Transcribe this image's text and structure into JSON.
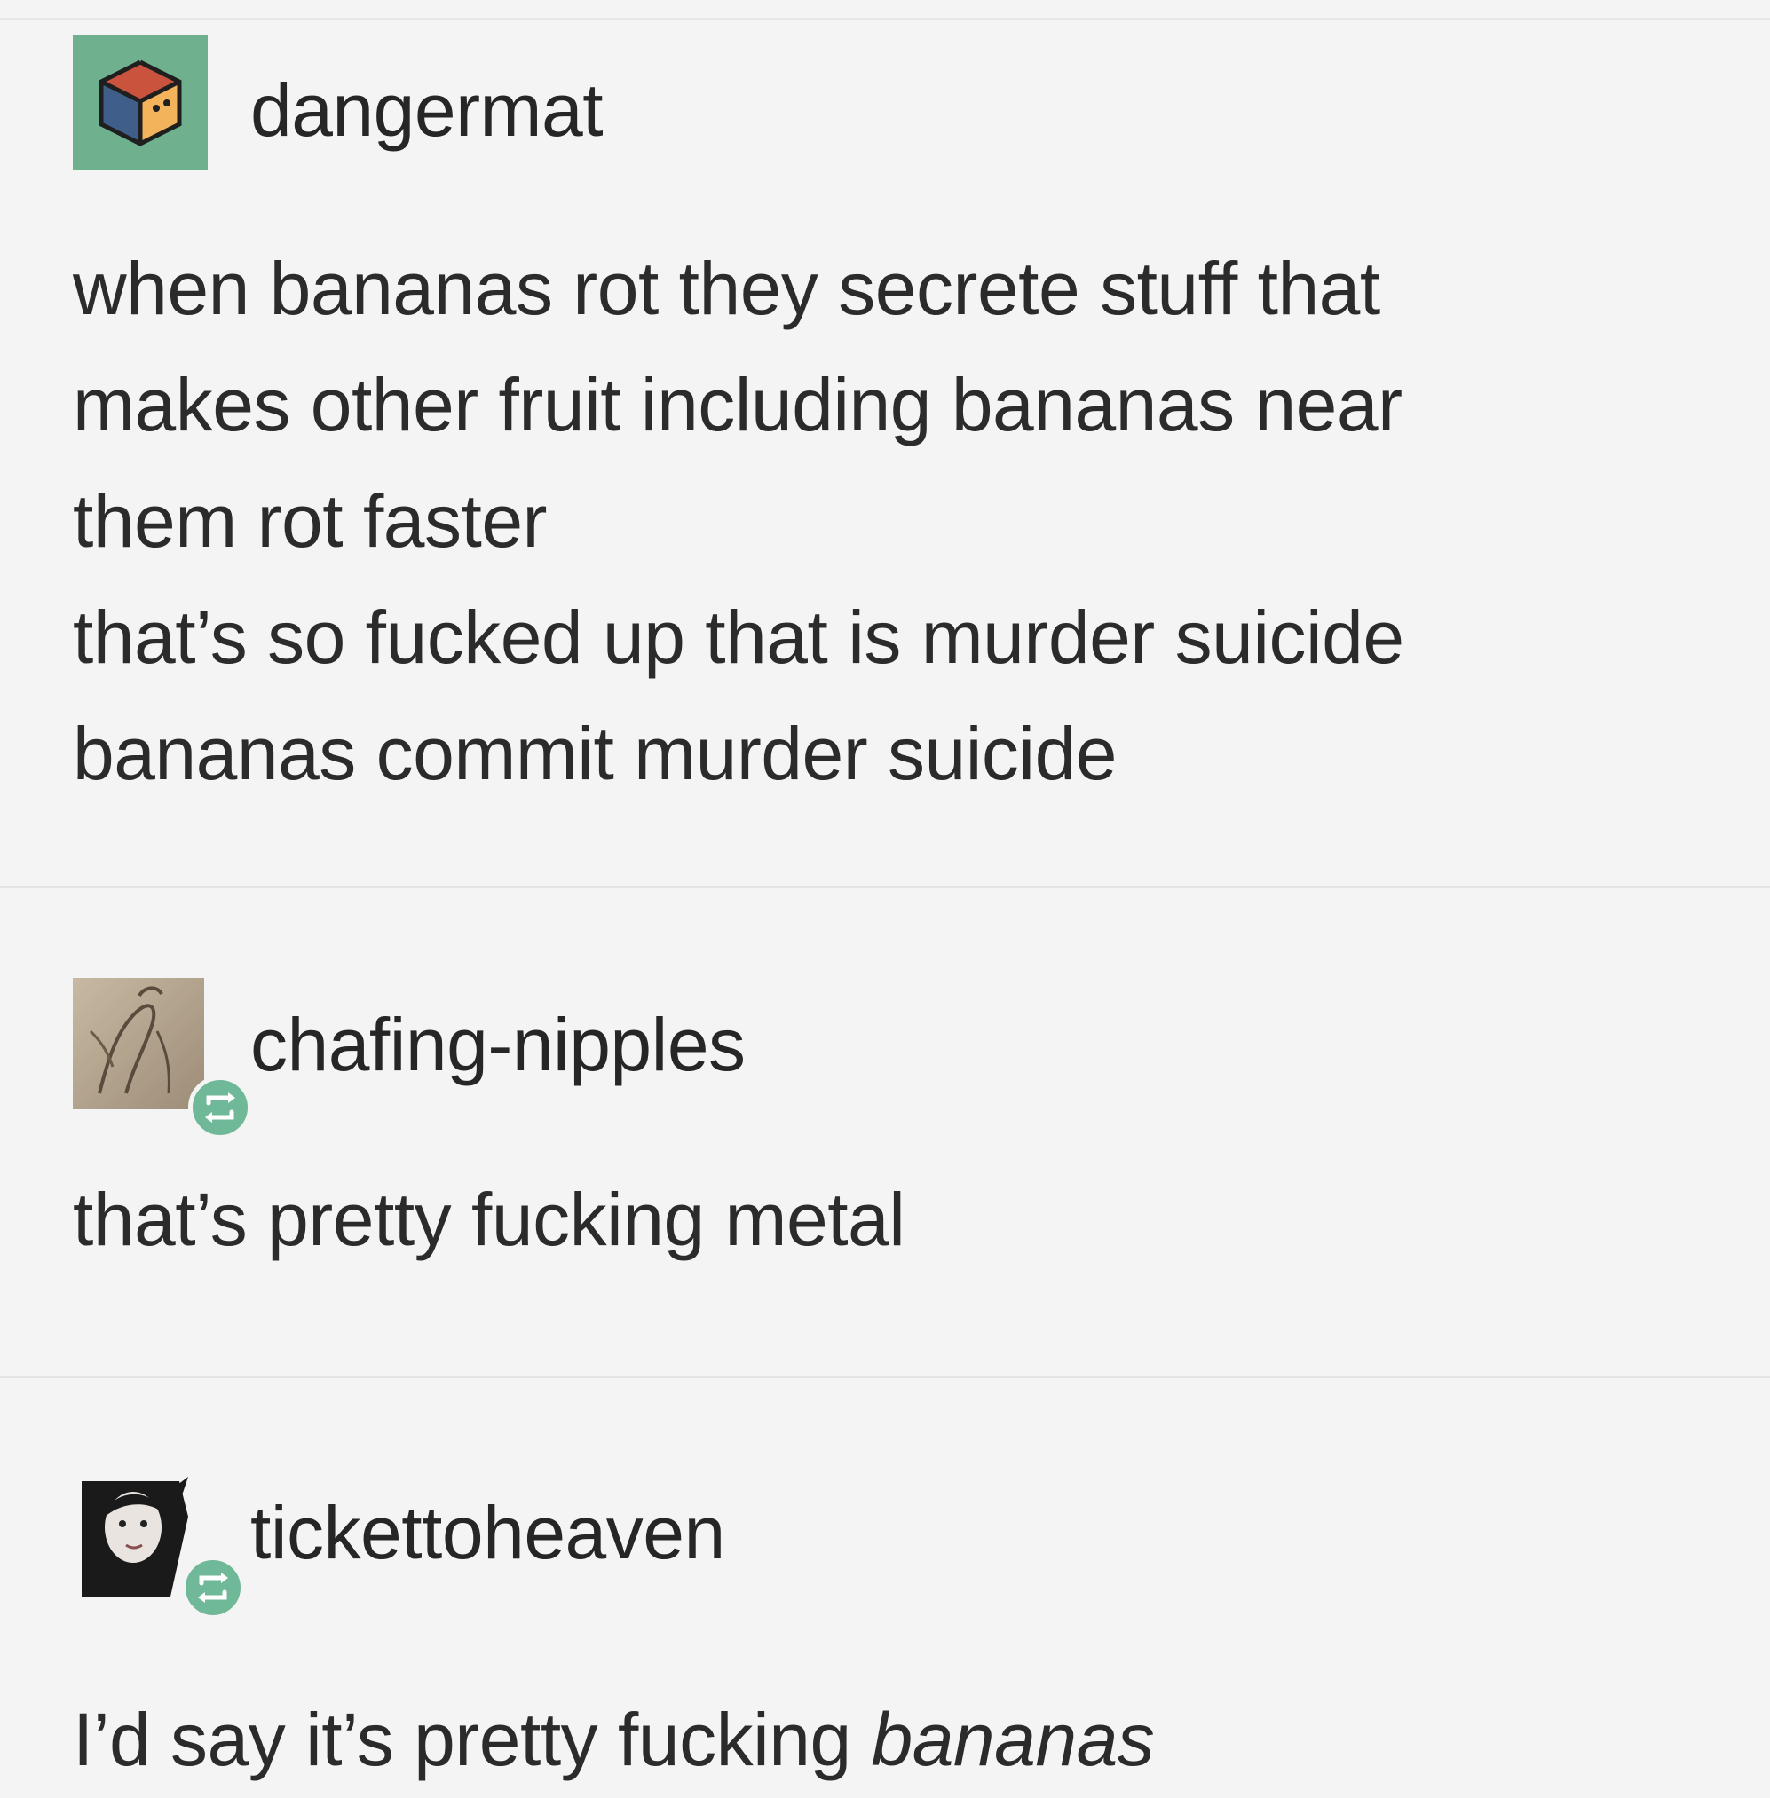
{
  "posts": [
    {
      "username": "dangermat",
      "avatar_icon": "cube-avatar-icon",
      "reblogged": false,
      "lines": [
        "when bananas rot they secrete stuff that",
        "makes other fruit including bananas near",
        "them rot faster",
        "that’s so fucked up that is murder suicide",
        "bananas commit murder suicide"
      ]
    },
    {
      "username": "chafing-nipples",
      "avatar_icon": "sketch-avatar-icon",
      "reblogged": true,
      "lines": [
        "that’s pretty fucking metal"
      ]
    },
    {
      "username": "tickettoheaven",
      "avatar_icon": "photo-avatar-icon",
      "reblogged": true,
      "text_prefix": "I’d say it’s pretty fucking ",
      "text_emphasis": "bananas"
    }
  ],
  "colors": {
    "background": "#f4f4f4",
    "reblog_badge": "#6fb898",
    "avatar_frame": "#6fb08e"
  }
}
